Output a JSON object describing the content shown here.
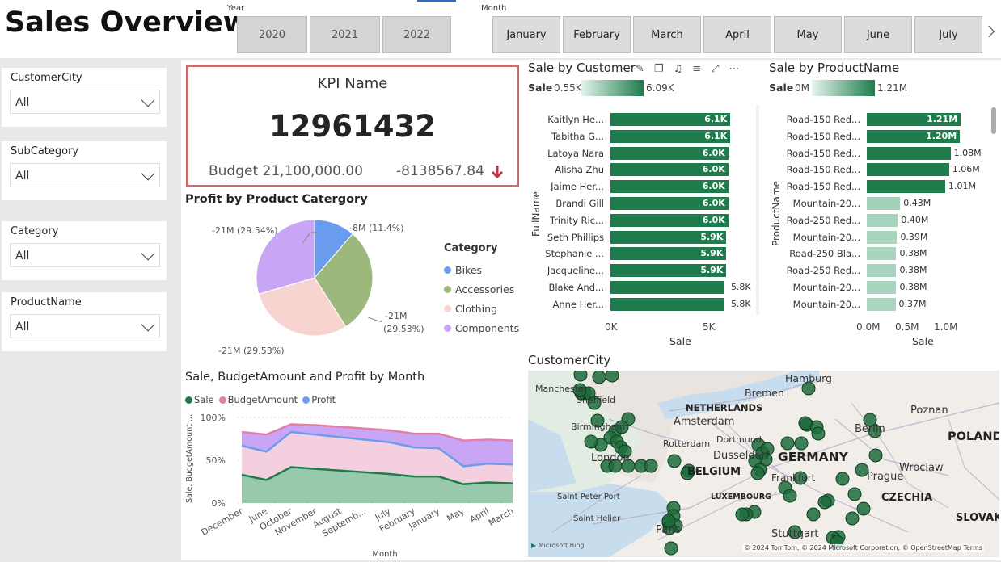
{
  "page": {
    "title": "Sales Overview"
  },
  "year_slicer": {
    "caption": "Year",
    "options": [
      "2020",
      "2021",
      "2022"
    ]
  },
  "month_slicer": {
    "caption": "Month",
    "options": [
      "January",
      "February",
      "March",
      "April",
      "May",
      "June",
      "July"
    ]
  },
  "filters": [
    {
      "label": "CustomerCity",
      "value": "All"
    },
    {
      "label": "SubCategory",
      "value": "All"
    },
    {
      "label": "Category",
      "value": "All"
    },
    {
      "label": "ProductName",
      "value": "All"
    }
  ],
  "kpi": {
    "name": "KPI Name",
    "value": "12961432",
    "budget": "Budget 21,100,000.00",
    "variance": "-8138567.84",
    "status_color": "#c4314b"
  },
  "pie": {
    "title": "Profit by Product Catergory",
    "legend_title": "Category",
    "slices": [
      {
        "name": "Bikes",
        "value": 11.4,
        "label": "-8M (11.4%)",
        "color": "#6a9ded"
      },
      {
        "name": "Accessories",
        "value": 29.53,
        "label": "-21M (29.53%)",
        "color": "#9cb87d"
      },
      {
        "name": "Clothing",
        "value": 29.53,
        "label": "-21M (29.53%)",
        "color": "#f7d4d0"
      },
      {
        "name": "Components",
        "value": 29.54,
        "label": "-21M (29.54%)",
        "color": "#c9a6f5"
      }
    ]
  },
  "customer_chart": {
    "title": "Sale by Customer",
    "legend_label": "Sale",
    "gradient_min": "0.55K",
    "gradient_max": "6.09K",
    "y_axis": "FullName",
    "x_axis": "Sale",
    "ticks": [
      "0K",
      "5K"
    ],
    "rows": [
      {
        "name": "Kaitlyn He...",
        "value": 6.1,
        "label": "6.1K"
      },
      {
        "name": "Tabitha G...",
        "value": 6.1,
        "label": "6.1K"
      },
      {
        "name": "Latoya Nara",
        "value": 6.0,
        "label": "6.0K"
      },
      {
        "name": "Alisha Zhu",
        "value": 6.0,
        "label": "6.0K"
      },
      {
        "name": "Jaime Her...",
        "value": 6.0,
        "label": "6.0K"
      },
      {
        "name": "Brandi Gill",
        "value": 6.0,
        "label": "6.0K"
      },
      {
        "name": "Trinity Ric...",
        "value": 6.0,
        "label": "6.0K"
      },
      {
        "name": "Seth Phillips",
        "value": 5.9,
        "label": "5.9K"
      },
      {
        "name": "Stephanie ...",
        "value": 5.9,
        "label": "5.9K"
      },
      {
        "name": "Jacqueline...",
        "value": 5.9,
        "label": "5.9K"
      },
      {
        "name": "Blake And...",
        "value": 5.8,
        "label": "5.8K"
      },
      {
        "name": "Anne Her...",
        "value": 5.8,
        "label": "5.8K"
      }
    ]
  },
  "product_chart": {
    "title": "Sale by ProductName",
    "legend_label": "Sale",
    "gradient_min": "0M",
    "gradient_max": "1.21M",
    "y_axis": "ProductName",
    "x_axis": "Sale",
    "ticks": [
      "0.0M",
      "0.5M",
      "1.0M"
    ],
    "rows": [
      {
        "name": "Road-150 Red...",
        "value": 1.21,
        "label": "1.21M"
      },
      {
        "name": "Road-150 Red...",
        "value": 1.2,
        "label": "1.20M"
      },
      {
        "name": "Road-150 Red...",
        "value": 1.08,
        "label": "1.08M"
      },
      {
        "name": "Road-150 Red...",
        "value": 1.06,
        "label": "1.06M"
      },
      {
        "name": "Road-150 Red...",
        "value": 1.01,
        "label": "1.01M"
      },
      {
        "name": "Mountain-20...",
        "value": 0.43,
        "label": "0.43M"
      },
      {
        "name": "Road-250 Red...",
        "value": 0.4,
        "label": "0.40M"
      },
      {
        "name": "Mountain-20...",
        "value": 0.39,
        "label": "0.39M"
      },
      {
        "name": "Road-250 Bla...",
        "value": 0.38,
        "label": "0.38M"
      },
      {
        "name": "Road-250 Red...",
        "value": 0.38,
        "label": "0.38M"
      },
      {
        "name": "Mountain-20...",
        "value": 0.38,
        "label": "0.38M"
      },
      {
        "name": "Mountain-20...",
        "value": 0.37,
        "label": "0.37M"
      }
    ]
  },
  "area_chart": {
    "title": "Sale, BudgetAmount and Profit by Month",
    "legend": [
      {
        "name": "Sale",
        "color": "#1e7c4c"
      },
      {
        "name": "BudgetAmount",
        "color": "#e37eaa"
      },
      {
        "name": "Profit",
        "color": "#6a9ded"
      }
    ],
    "y_axis": "Sale, BudgetAmount ...",
    "x_axis": "Month",
    "y_ticks": [
      "100%",
      "50%",
      "0%"
    ]
  },
  "chart_data": {
    "type": "area",
    "categories": [
      "December",
      "June",
      "October",
      "November",
      "August",
      "Septemb...",
      "July",
      "February",
      "January",
      "May",
      "April",
      "March"
    ],
    "series": [
      {
        "name": "Sale",
        "values": [
          33,
          27,
          42,
          40,
          38,
          36,
          34,
          31,
          31,
          22,
          24,
          23
        ]
      },
      {
        "name": "BudgetAmount",
        "values": [
          83,
          80,
          92,
          91,
          89,
          87,
          85,
          81,
          81,
          73,
          74,
          73
        ]
      },
      {
        "name": "Profit",
        "values": [
          67,
          60,
          83,
          80,
          77,
          74,
          71,
          65,
          64,
          43,
          46,
          45
        ]
      }
    ],
    "ylim": [
      0,
      100
    ],
    "ylabel": "Sale, BudgetAmount ...",
    "xlabel": "Month"
  },
  "map": {
    "title": "CustomerCity",
    "labels": [
      "Hamburg",
      "Bremen",
      "Manchester",
      "Sheffield",
      "NETHERLANDS",
      "Amsterdam",
      "Poznan",
      "Berlin",
      "Birmingham",
      "Rotterdam",
      "Dortmund",
      "Dusseldorf",
      "POLAND",
      "London",
      "BELGIUM",
      "GERMANY",
      "Wroclaw",
      "Frankfurt",
      "Prague",
      "LUXEMBOURG",
      "CZECHIA",
      "Saint Peter Port",
      "SLOVAK",
      "Saint Helier",
      "Paris",
      "Stuttgart"
    ],
    "footer": "© 2024 TomTom, © 2024 Microsoft Corporation, © OpenStreetMap Terms",
    "brand": "Microsoft Bing"
  }
}
